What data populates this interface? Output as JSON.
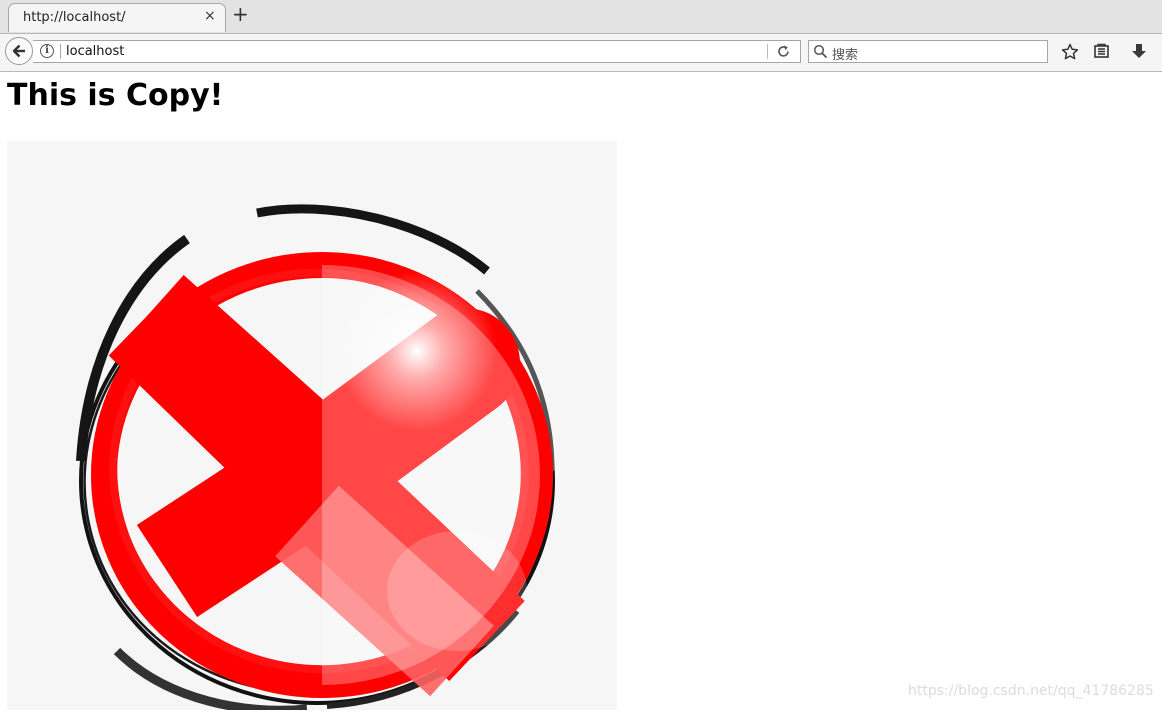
{
  "browser": {
    "tab": {
      "title": "http://localhost/",
      "close_label": "×"
    },
    "new_tab_label": "+",
    "url": "localhost",
    "search": {
      "placeholder": "搜索"
    },
    "icons": {
      "back": "back-arrow-icon",
      "info": "info-icon",
      "reload": "reload-icon",
      "search": "search-icon",
      "bookmark": "star-icon",
      "reader": "reader-list-icon",
      "download": "download-icon"
    },
    "info_glyph": "i"
  },
  "page": {
    "heading": "This is Copy!",
    "image": {
      "icon": "red-cross-sphere-icon",
      "colors": {
        "cross": "#ff0000",
        "ring_dark": "#111111",
        "background": "#f6f6f6"
      }
    }
  },
  "watermark": "https://blog.csdn.net/qq_41786285"
}
